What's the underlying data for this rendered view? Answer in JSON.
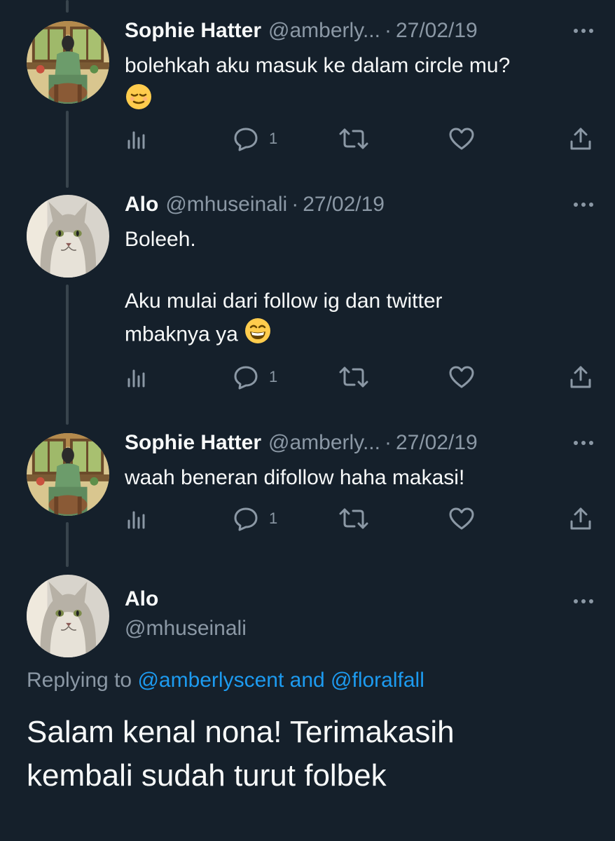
{
  "tweets": [
    {
      "name": "Sophie Hatter",
      "handle": "@amberly...",
      "dot": "·",
      "date": "27/02/19",
      "text_lines": [
        "bolehkah aku masuk ke dalam circle mu?"
      ],
      "emoji": "relieved-face",
      "reply_count": "1",
      "avatar": "girl-window-avatar"
    },
    {
      "name": "Alo",
      "handle": "@mhuseinali",
      "dot": "·",
      "date": "27/02/19",
      "text_lines": [
        "Boleeh.",
        "",
        "Aku mulai dari follow ig dan twitter",
        "mbaknya ya"
      ],
      "emoji": "grinning-face",
      "reply_count": "1",
      "avatar": "cat-avatar"
    },
    {
      "name": "Sophie Hatter",
      "handle": "@amberly...",
      "dot": "·",
      "date": "27/02/19",
      "text_lines": [
        "waah beneran difollow haha makasi!"
      ],
      "reply_count": "1",
      "avatar": "girl-window-avatar"
    }
  ],
  "main_tweet": {
    "name": "Alo",
    "handle": "@mhuseinali",
    "replying_prefix": "Replying to",
    "reply_to_1": "@amberlyscent",
    "reply_and": "and",
    "reply_to_2": "@floralfall",
    "text_line1": "Salam kenal nona! Terimakasih",
    "text_line2": "kembali sudah turut folbek",
    "avatar": "cat-avatar"
  },
  "icons": [
    "views-icon",
    "reply-icon",
    "retweet-icon",
    "like-icon",
    "share-icon",
    "more-icon"
  ],
  "colors": {
    "background": "#15202b",
    "muted": "#8b98a5",
    "text": "#f7f9f9",
    "link": "#1d9bf0",
    "thread_line": "#38444d"
  }
}
